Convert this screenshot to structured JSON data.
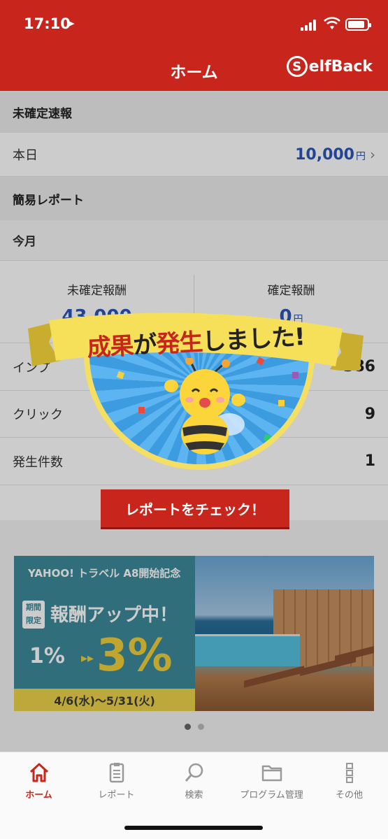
{
  "status_bar": {
    "time": "17:10",
    "location_arrow": "location-arrow-icon"
  },
  "nav": {
    "title": "ホーム",
    "brand": "elfBack",
    "brand_badge": "S"
  },
  "unconfirmed": {
    "heading": "未確定速報",
    "today_label": "本日",
    "today_value": "10,000",
    "today_unit": "円"
  },
  "simple_report": {
    "heading": "簡易レポート",
    "period": "今月",
    "unconfirmed_label": "未確定報酬",
    "unconfirmed_value": "43,000",
    "confirmed_label": "確定報酬",
    "confirmed_value": "0",
    "confirmed_unit": "円",
    "rows": [
      {
        "label": "インプ",
        "value": "386"
      },
      {
        "label": "クリック",
        "value": "9"
      },
      {
        "label": "発生件数",
        "value": "1"
      }
    ]
  },
  "banner": {
    "brand": "YAHOO! トラベル",
    "campaign": "A8開始記念",
    "badge": "期間限定",
    "headline": "報酬アップ中！",
    "from_pct": "1%",
    "to_pct": "3%",
    "dates": "4/6(水)〜5/31(火)",
    "pages": 2,
    "current_page": 1
  },
  "popup": {
    "title_red_1": "成果",
    "title_black_1": "が",
    "title_red_2": "発生",
    "title_black_2": "しました!",
    "button_label": "レポートをチェック！"
  },
  "tabs": [
    {
      "label": "ホーム",
      "icon": "home-icon",
      "active": true
    },
    {
      "label": "レポート",
      "icon": "report-icon",
      "active": false
    },
    {
      "label": "検索",
      "icon": "search-icon",
      "active": false
    },
    {
      "label": "プログラム管理",
      "icon": "folder-icon",
      "active": false
    },
    {
      "label": "その他",
      "icon": "more-icon",
      "active": false
    }
  ],
  "colors": {
    "brand_red": "#c8261c",
    "value_blue": "#2b56b8",
    "banner_teal": "#3b8a99",
    "banner_yellow": "#ecd34a"
  }
}
